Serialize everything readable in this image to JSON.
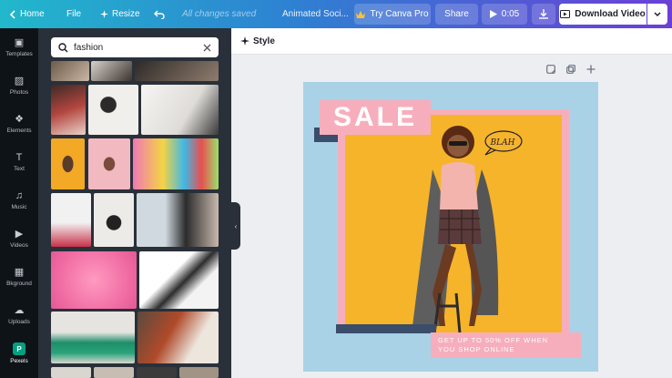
{
  "topbar": {
    "home_label": "Home",
    "file_label": "File",
    "resize_label": "Resize",
    "save_status": "All changes saved",
    "design_title": "Animated Soci...",
    "try_pro_label": "Try Canva Pro",
    "share_label": "Share",
    "play_duration": "0:05",
    "download_video_label": "Download Video"
  },
  "rail": {
    "items": [
      {
        "label": "Templates",
        "icon": "templates-icon"
      },
      {
        "label": "Photos",
        "icon": "photos-icon"
      },
      {
        "label": "Elements",
        "icon": "elements-icon"
      },
      {
        "label": "Text",
        "icon": "text-icon"
      },
      {
        "label": "Music",
        "icon": "music-icon"
      },
      {
        "label": "Videos",
        "icon": "videos-icon"
      },
      {
        "label": "Bkground",
        "icon": "background-icon"
      },
      {
        "label": "Uploads",
        "icon": "uploads-icon"
      },
      {
        "label": "Pexels",
        "icon": "pexels-icon",
        "active": true
      }
    ]
  },
  "panel": {
    "search_value": "fashion",
    "colors": {
      "panel_bg": "#293039"
    }
  },
  "editor": {
    "style_label": "Style"
  },
  "design": {
    "headline": "SALE",
    "bubble_text": "BLAH",
    "promo_line1": "GET UP TO 50% OFF WHEN",
    "promo_line2": "YOU SHOP ONLINE",
    "colors": {
      "background": "#a9d2e6",
      "pink": "#f7aebc",
      "photo": "#f6b42a",
      "navy": "#3a4d6a"
    }
  }
}
